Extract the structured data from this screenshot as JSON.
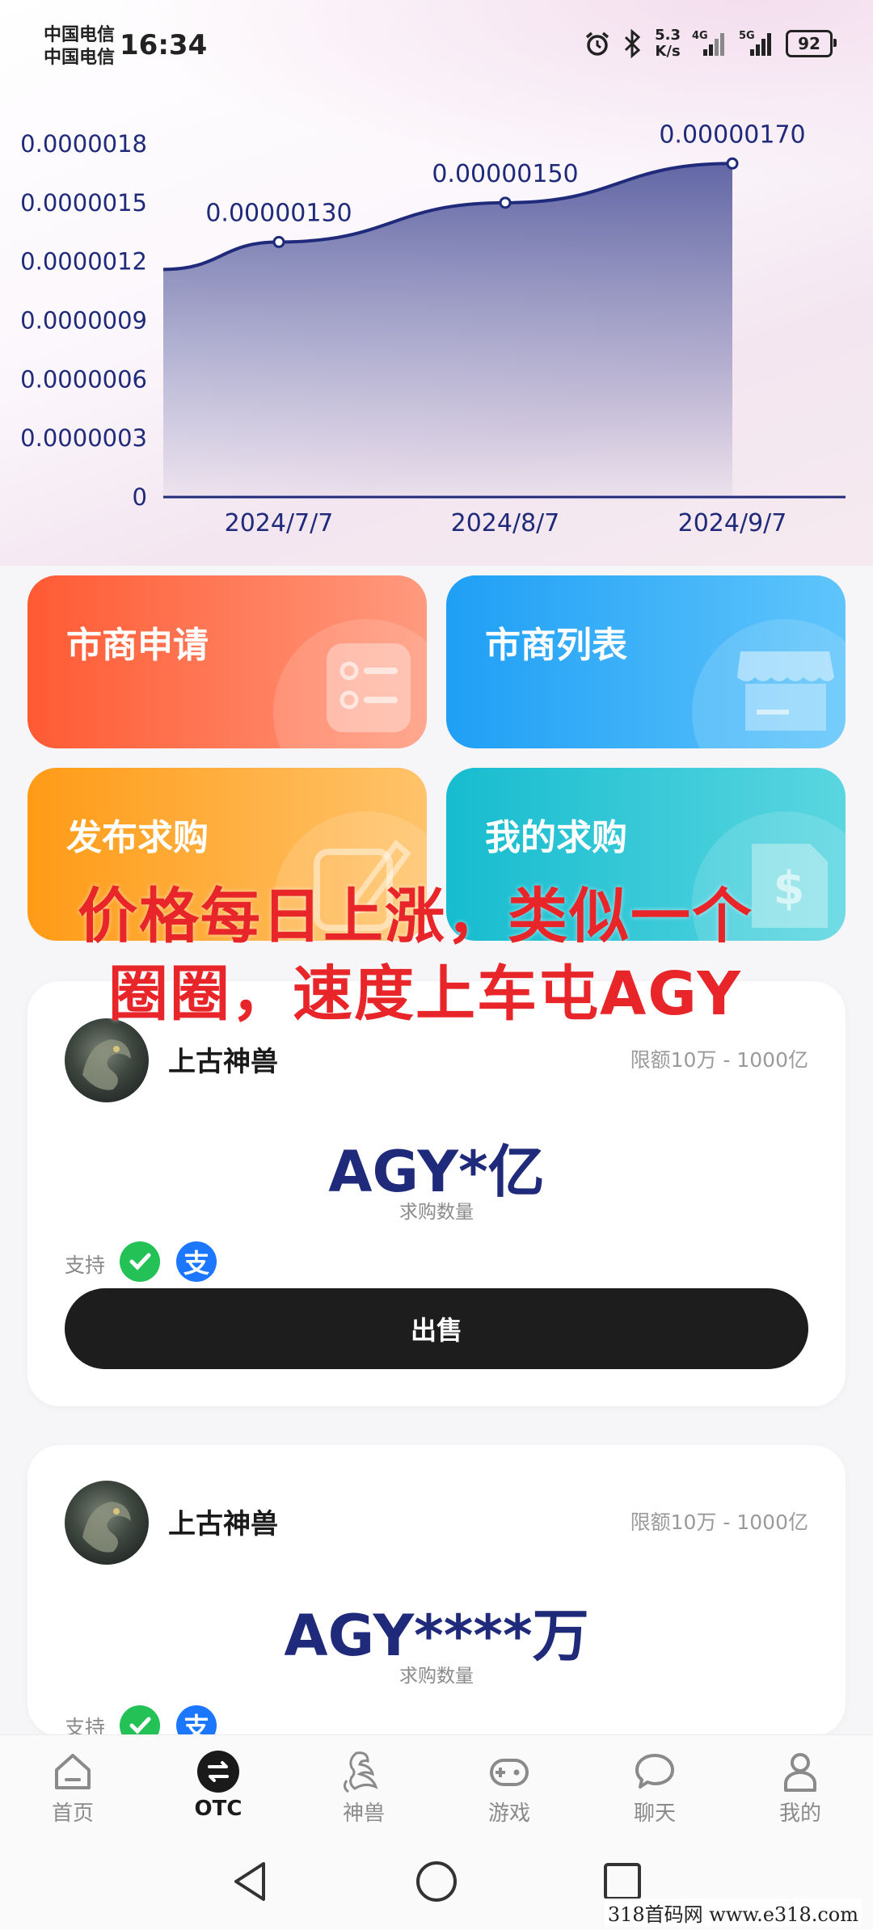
{
  "status_bar": {
    "carrier_1": "中国电信",
    "carrier_2": "中国电信",
    "time": "16:34",
    "net_speed_value": "5.3",
    "net_speed_unit": "K/s",
    "signal_1_label": "4G",
    "signal_2_label": "5G",
    "battery": "92"
  },
  "chart_data": {
    "type": "area",
    "x": [
      "2024/7/7",
      "2024/8/7",
      "2024/9/7"
    ],
    "series": [
      {
        "values": [
          1.3e-06,
          1.5e-06,
          1.7e-06
        ]
      }
    ],
    "start_value": 1.16e-06,
    "data_labels": [
      "0.00000130",
      "0.00000150",
      "0.00000170"
    ],
    "y_ticks": [
      "0",
      "0.0000003",
      "0.0000006",
      "0.0000009",
      "0.0000012",
      "0.0000015",
      "0.0000018"
    ],
    "ylim": [
      0,
      1.8e-06
    ],
    "grid": false,
    "line_color": "#1f2a7a",
    "fill_color": "#5a5fa0"
  },
  "tiles": {
    "market_apply": "市商申请",
    "market_list": "市商列表",
    "publish_buy": "发布求购",
    "my_buy": "我的求购"
  },
  "overlay": {
    "line1": "价格每日上涨，类似一个",
    "line2": "圈圈，速度上车屯AGY",
    "color": "#e8262a"
  },
  "cards": [
    {
      "user": "上古神兽",
      "limit": "限额10万 - 1000亿",
      "amount": "AGY*亿",
      "amount_label": "求购数量",
      "support": "支持",
      "alipay_glyph": "支",
      "sell": "出售"
    },
    {
      "user": "上古神兽",
      "limit": "限额10万 - 1000亿",
      "amount": "AGY****万",
      "amount_label": "求购数量",
      "support": "支持",
      "alipay_glyph": "支"
    }
  ],
  "tabbar": [
    {
      "label": "首页",
      "icon": "home-icon"
    },
    {
      "label": "OTC",
      "icon": "exchange-icon",
      "active": true
    },
    {
      "label": "神兽",
      "icon": "dragon-icon"
    },
    {
      "label": "游戏",
      "icon": "gamepad-icon"
    },
    {
      "label": "聊天",
      "icon": "chat-icon"
    },
    {
      "label": "我的",
      "icon": "profile-icon"
    }
  ],
  "watermark": "318首码网  www.e318.com"
}
